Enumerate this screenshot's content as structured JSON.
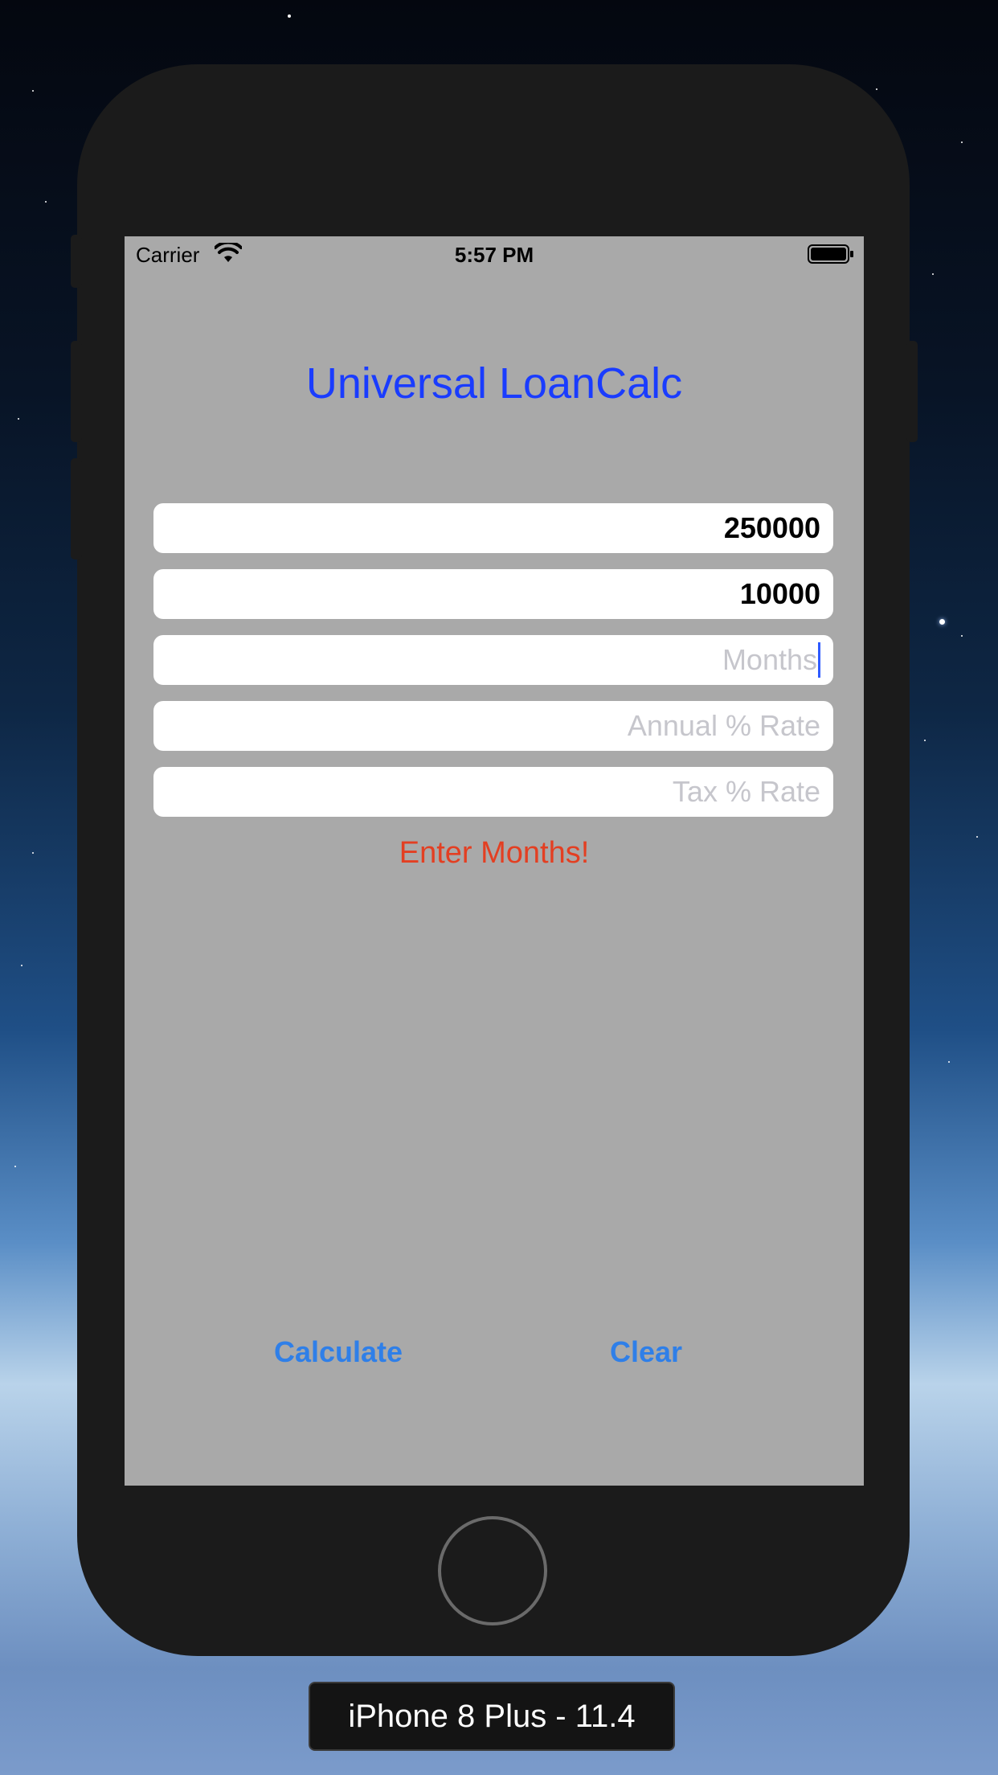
{
  "simulator": {
    "device_label": "iPhone 8 Plus - 11.4"
  },
  "status_bar": {
    "carrier": "Carrier",
    "time": "5:57 PM",
    "icons": [
      "wifi-icon",
      "battery-icon"
    ]
  },
  "app": {
    "title": "Universal LoanCalc",
    "fields": {
      "principal": {
        "value": "250000"
      },
      "down_payment": {
        "value": "10000"
      },
      "months": {
        "value": "",
        "placeholder": "Months"
      },
      "annual_rate": {
        "value": "",
        "placeholder": "Annual % Rate"
      },
      "tax_rate": {
        "value": "",
        "placeholder": "Tax % Rate"
      }
    },
    "message": "Enter Months!",
    "buttons": {
      "calculate": "Calculate",
      "clear": "Clear"
    }
  },
  "colors": {
    "title": "#1a3cff",
    "error": "#e33f22",
    "button": "#2f7fe8",
    "screen_background": "#a9a9a9"
  }
}
